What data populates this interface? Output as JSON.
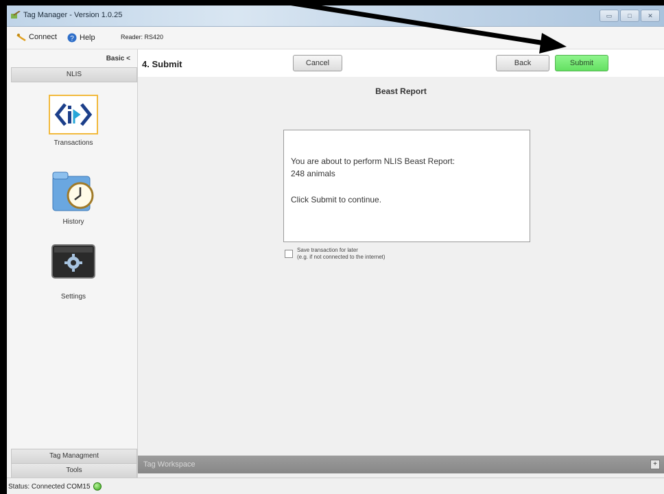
{
  "window": {
    "title": "Tag Manager - Version 1.0.25",
    "controls": [
      "▭",
      "□",
      "✕"
    ]
  },
  "menubar": {
    "connect": "Connect",
    "help": "Help",
    "reader": "Reader: RS420"
  },
  "sidebar": {
    "mode_toggle": "Basic <",
    "section_top": "NLIS",
    "items": [
      {
        "label": "Transactions",
        "icon": "nlis-id-icon"
      },
      {
        "label": "History",
        "icon": "clock-folder-icon"
      },
      {
        "label": "Settings",
        "icon": "gear-icon"
      }
    ],
    "section_tag": "Tag Managment",
    "section_tools": "Tools"
  },
  "main": {
    "step_title": "4. Submit",
    "cancel_label": "Cancel",
    "back_label": "Back",
    "submit_label": "Submit",
    "report_title": "Beast Report",
    "message_line1": "You are about to perform NLIS Beast Report:",
    "message_line2": "248 animals",
    "message_line3": "Click Submit to continue.",
    "save_line1": "Save transaction for later",
    "save_line2": "(e.g. if not connected to the internet)",
    "save_checked": false
  },
  "workspace": {
    "label": "Tag Workspace",
    "expand": "+"
  },
  "status": {
    "text": "Status: Connected COM15"
  },
  "colors": {
    "submit_green": "#6fe86d",
    "status_green": "#34a416",
    "arrow": "#000000"
  }
}
